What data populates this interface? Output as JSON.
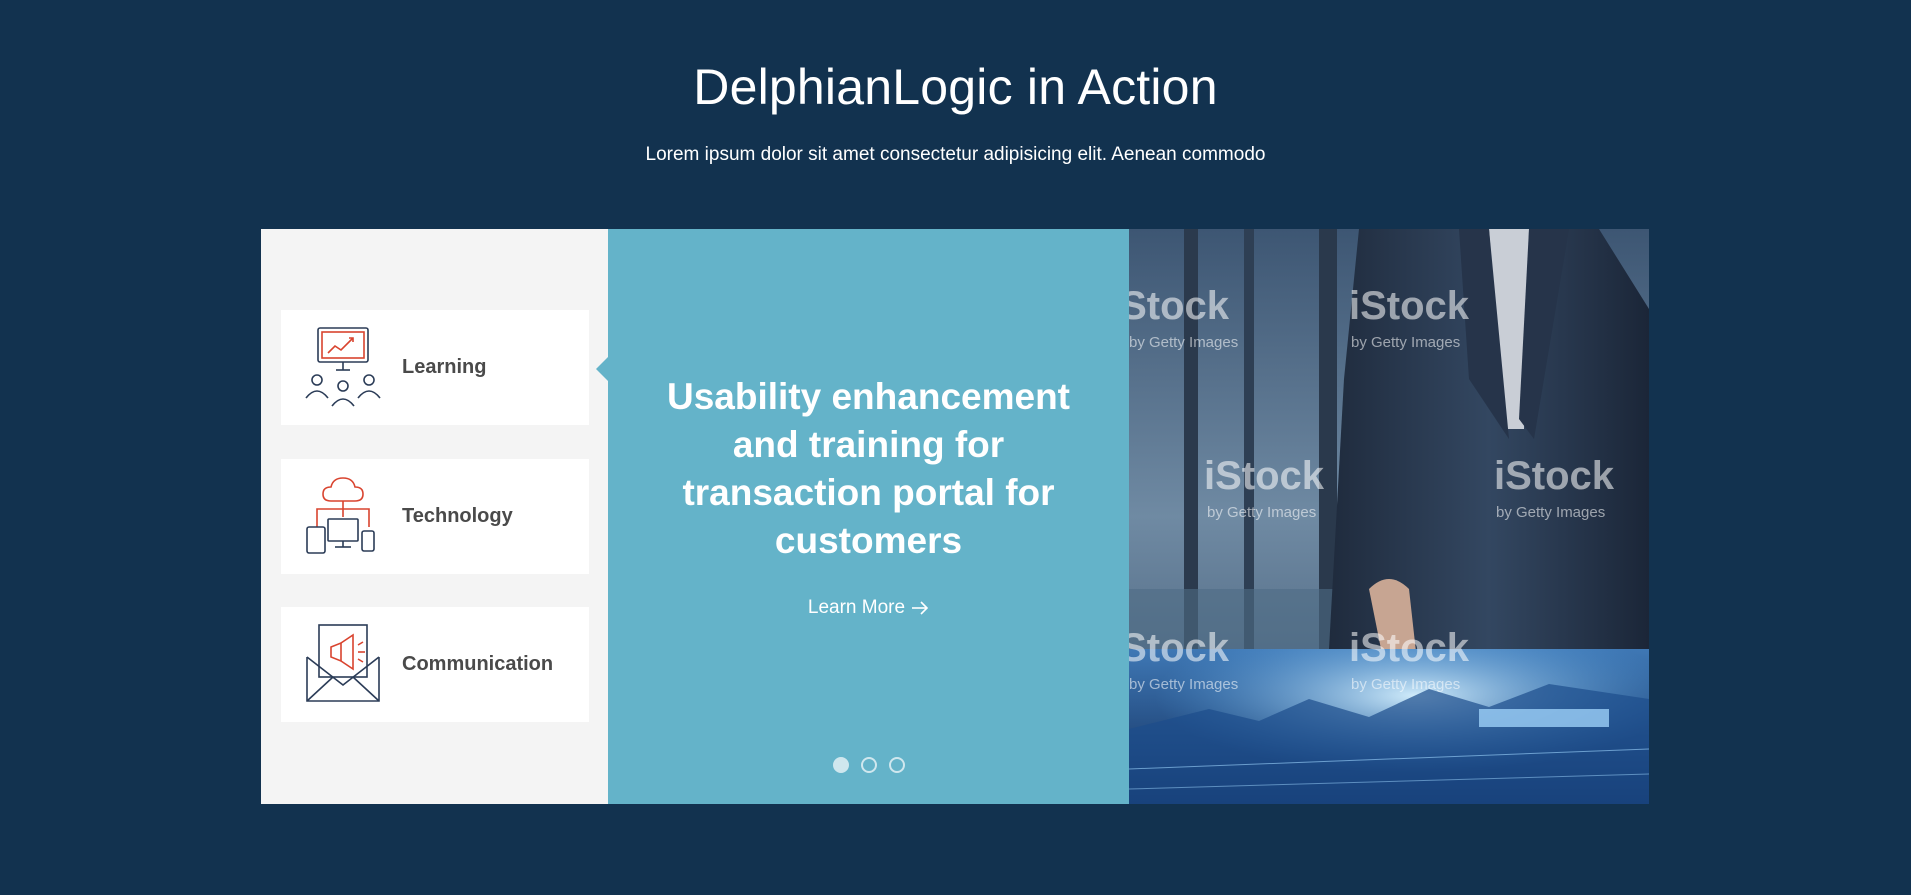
{
  "section": {
    "title": "DelphianLogic in Action",
    "subtitle": "Lorem ipsum dolor sit amet consectetur adipisicing elit. Aenean commodo"
  },
  "tabs": [
    {
      "label": "Learning",
      "icon": "presentation-audience-icon"
    },
    {
      "label": "Technology",
      "icon": "cloud-devices-icon"
    },
    {
      "label": "Communication",
      "icon": "envelope-megaphone-icon"
    }
  ],
  "active_tab_index": 0,
  "slide": {
    "title": "Usability enhancement and training for transaction portal for customers",
    "link_label": "Learn More",
    "link_icon": "arrow-right-icon"
  },
  "carousel": {
    "slide_count": 3,
    "active_index": 0
  },
  "photo": {
    "watermark_brand": "iStock",
    "watermark_sub": "by Getty Images"
  },
  "colors": {
    "background": "#12324f",
    "accent": "#64b3c9",
    "tab_panel": "#f4f4f4",
    "icon_red": "#d9442f",
    "icon_navy": "#2b3c57"
  }
}
